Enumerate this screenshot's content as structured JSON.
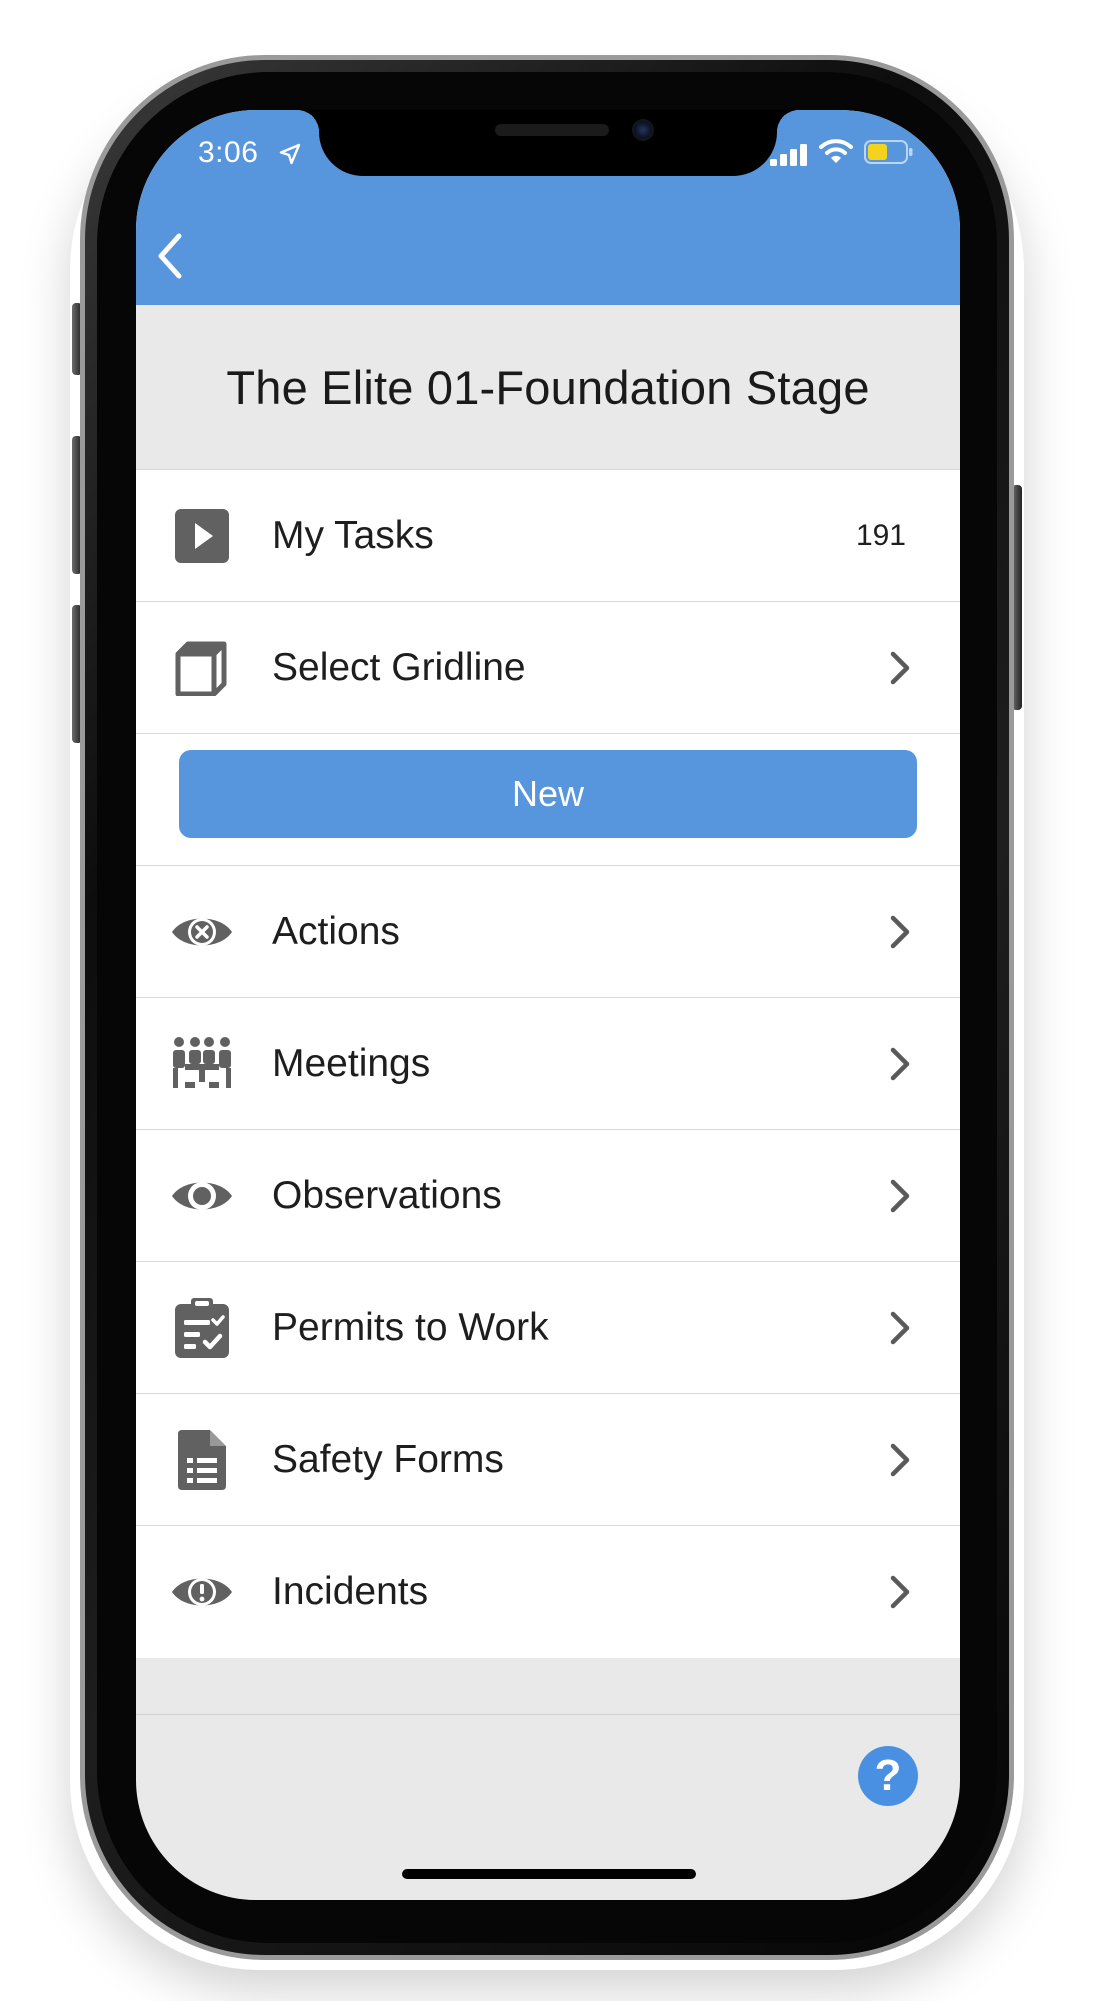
{
  "status_bar": {
    "time": "3:06"
  },
  "page": {
    "title": "The Elite 01-Foundation Stage"
  },
  "menu": {
    "items": [
      {
        "label": "My Tasks",
        "count": "191",
        "icon": "play-square-icon"
      },
      {
        "label": "Select Gridline",
        "icon": "cube-icon"
      },
      {
        "label": "Actions",
        "icon": "eye-cross-icon"
      },
      {
        "label": "Meetings",
        "icon": "meeting-people-icon"
      },
      {
        "label": "Observations",
        "icon": "eye-icon"
      },
      {
        "label": "Permits to Work",
        "icon": "clipboard-check-icon"
      },
      {
        "label": "Safety Forms",
        "icon": "document-list-icon"
      },
      {
        "label": "Incidents",
        "icon": "eye-exclamation-icon"
      }
    ],
    "new_button_label": "New"
  },
  "help": {
    "label": "?"
  },
  "colors": {
    "accent": "#5796dd",
    "icon_gray": "#616161",
    "background": "#e9e9e9"
  }
}
